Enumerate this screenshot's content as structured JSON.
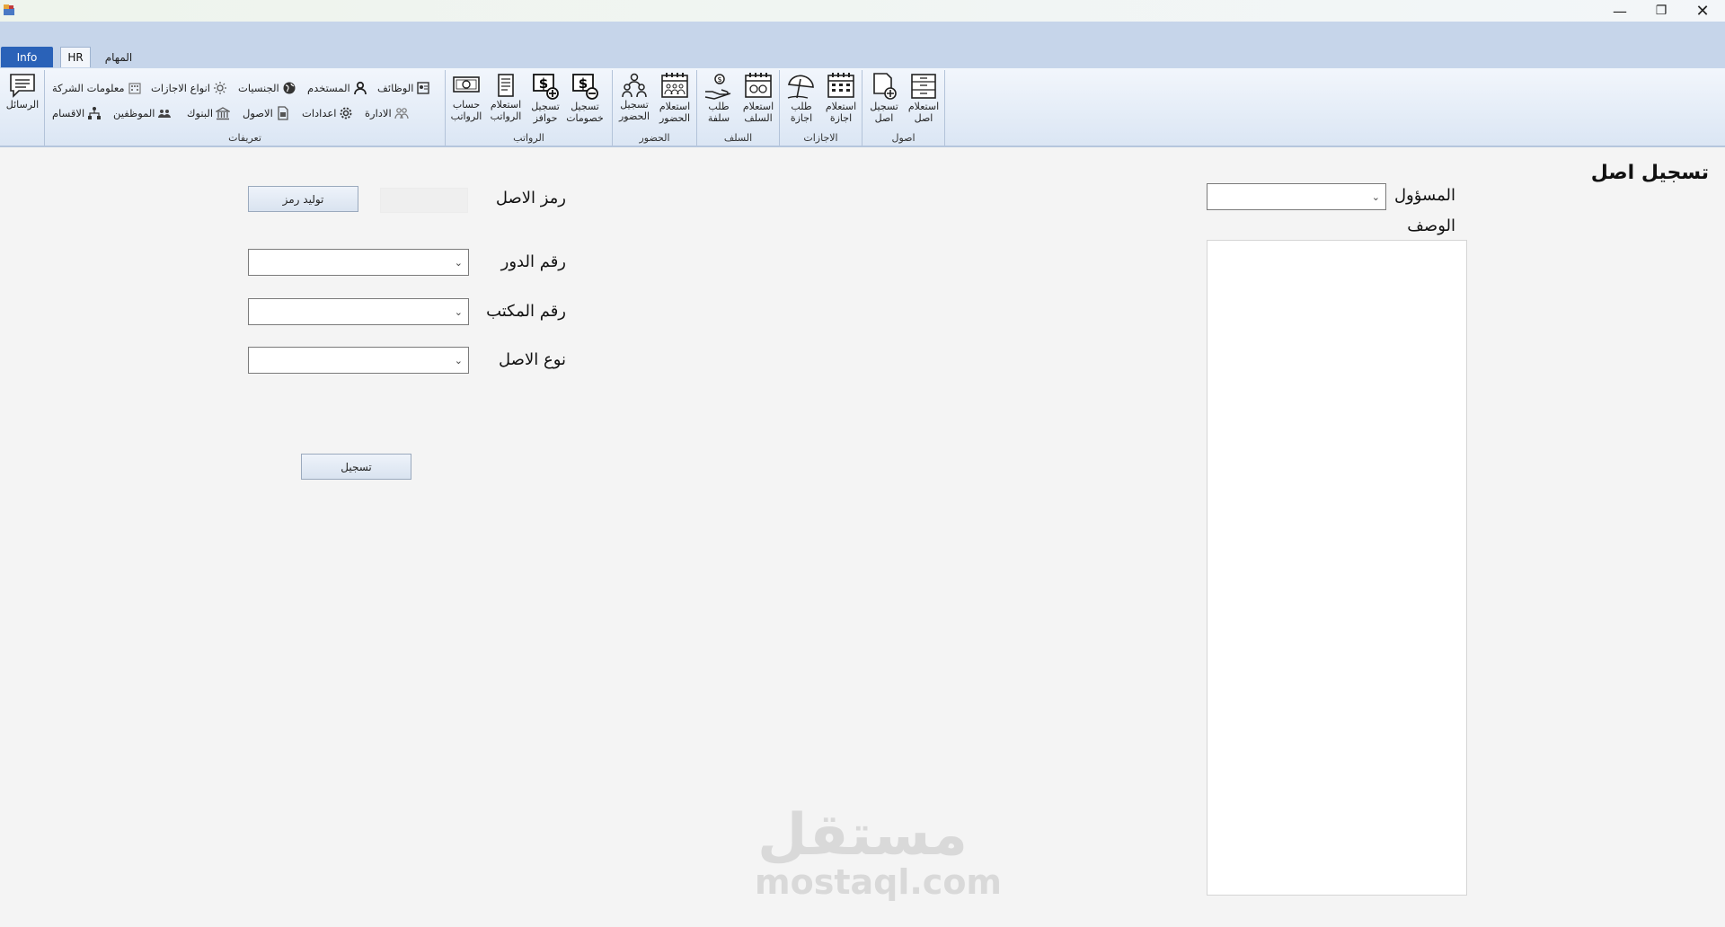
{
  "window": {
    "minimize": "—",
    "maximize": "❐",
    "close": "✕"
  },
  "tabs": {
    "info": "Info",
    "hr": "HR",
    "tasks": "المهام"
  },
  "ribbon": {
    "messages": "الرسائل",
    "definitions": {
      "label": "تعريفات",
      "jobs": "الوظائف",
      "user": "المستخدم",
      "nationalities": "الجنسيات",
      "leave_types": "انواع الاجازات",
      "company_info": "معلومات الشركة",
      "administration": "الادارة",
      "settings": "اعدادات",
      "assets": "الاصول",
      "banks": "البنوك",
      "employees": "الموظفين",
      "departments": "الاقسام"
    },
    "salaries": {
      "label": "الرواتب",
      "calc_line1": "حساب",
      "calc_line2": "الرواتب",
      "query_line1": "استعلام",
      "query_line2": "الرواتب",
      "bonus_line1": "تسجيل",
      "bonus_line2": "حوافز",
      "deduct_line1": "تسجيل",
      "deduct_line2": "خصومات"
    },
    "attendance": {
      "label": "الحضور",
      "record_line1": "تسجيل",
      "record_line2": "الحضور",
      "query_line1": "استعلام",
      "query_line2": "الحضور"
    },
    "advances": {
      "label": "السلف",
      "request_line1": "طلب",
      "request_line2": "سلفة",
      "query_line1": "استعلام",
      "query_line2": "السلف"
    },
    "leaves": {
      "label": "الاجازات",
      "request_line1": "طلب",
      "request_line2": "اجازة",
      "query_line1": "استعلام",
      "query_line2": "اجازة"
    },
    "assets": {
      "label": "اصول",
      "record_line1": "تسجيل",
      "record_line2": "اصل",
      "query_line1": "استعلام",
      "query_line2": "اصل"
    }
  },
  "form": {
    "title": "تسجيل اصل",
    "responsible_label": "المسؤول",
    "description_label": "الوصف",
    "asset_code_label": "رمز الاصل",
    "generate_code_button": "توليد رمز",
    "floor_label": "رقم الدور",
    "office_label": "رقم المكتب",
    "asset_type_label": "نوع الاصل",
    "submit_button": "تسجيل"
  },
  "watermark": {
    "arabic": "مستقل",
    "latin": "mostaql.com"
  }
}
